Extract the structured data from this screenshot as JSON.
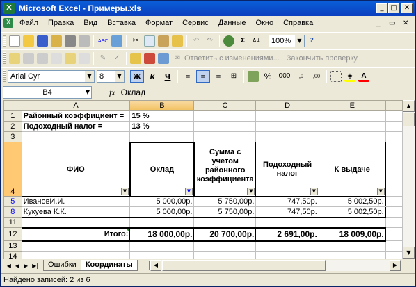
{
  "window": {
    "title": "Microsoft Excel - Примеры.xls"
  },
  "menu": [
    "Файл",
    "Правка",
    "Вид",
    "Вставка",
    "Формат",
    "Сервис",
    "Данные",
    "Окно",
    "Справка"
  ],
  "toolbar": {
    "zoom": "100%",
    "review_reply": "Ответить с изменениями...",
    "review_end": "Закончить проверку..."
  },
  "format": {
    "font": "Arial Cyr",
    "size": "8",
    "bold": "Ж",
    "italic": "К",
    "underline": "Ч",
    "percent": "%",
    "thousands": "000"
  },
  "formula_bar": {
    "cell": "B4",
    "fx": "fx",
    "value": "Оклад"
  },
  "columns": [
    "A",
    "B",
    "C",
    "D",
    "E"
  ],
  "rows": {
    "r1": {
      "num": "1",
      "a": "Районный коэффициент =",
      "b": "15 %"
    },
    "r2": {
      "num": "2",
      "a": "Подоходный налог =",
      "b": "13 %"
    },
    "r3": {
      "num": "3"
    },
    "r4": {
      "num": "4",
      "a": "ФИО",
      "b": "Оклад",
      "c": "Сумма с учетом районного коэффициента",
      "d": "Подоходный налог",
      "e": "К выдаче"
    },
    "r5": {
      "num": "5",
      "a": "ИвановИ.И.",
      "b": "5 000,00р.",
      "c": "5 750,00р.",
      "d": "747,50р.",
      "e": "5 002,50р."
    },
    "r8": {
      "num": "8",
      "a": "Кукуева К.К.",
      "b": "5 000,00р.",
      "c": "5 750,00р.",
      "d": "747,50р.",
      "e": "5 002,50р."
    },
    "r11": {
      "num": "11"
    },
    "r12": {
      "num": "12",
      "a": "Итого:",
      "b": "18 000,00р.",
      "c": "20 700,00р.",
      "d": "2 691,00р.",
      "e": "18 009,00р."
    },
    "r13": {
      "num": "13"
    },
    "r14": {
      "num": "14"
    }
  },
  "sheets": [
    "Ошибки",
    "Координаты"
  ],
  "status": "Найдено записей: 2 из 6"
}
